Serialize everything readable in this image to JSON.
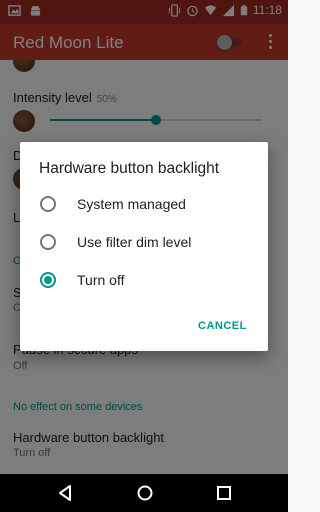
{
  "status_bar": {
    "time": "11:18",
    "icons": [
      "image-icon",
      "android-icon",
      "vibrate-icon",
      "alarm-icon",
      "wifi-icon",
      "signal-icon",
      "battery-icon"
    ]
  },
  "app_bar": {
    "title": "Red Moon Lite",
    "filter_toggle_on": false
  },
  "settings": {
    "intensity": {
      "label": "Intensity level",
      "value": "50%",
      "level": 0.5
    },
    "dim_label_partial": "D",
    "row3_partial": "L",
    "section1_partial": "O",
    "row4_partial": "S",
    "row4_sub_partial": "C",
    "pause": {
      "label": "Pause in secure apps",
      "value": "Off"
    },
    "section_no_effect": "No effect on some devices",
    "backlight": {
      "label": "Hardware button backlight",
      "value": "Turn off"
    }
  },
  "dialog": {
    "title": "Hardware button backlight",
    "options": [
      {
        "label": "System managed",
        "selected": false
      },
      {
        "label": "Use filter dim level",
        "selected": false
      },
      {
        "label": "Turn off",
        "selected": true
      }
    ],
    "cancel_label": "CANCEL"
  },
  "colors": {
    "primary": "#c0392b",
    "primary_dark": "#a02a22",
    "accent": "#009688"
  }
}
